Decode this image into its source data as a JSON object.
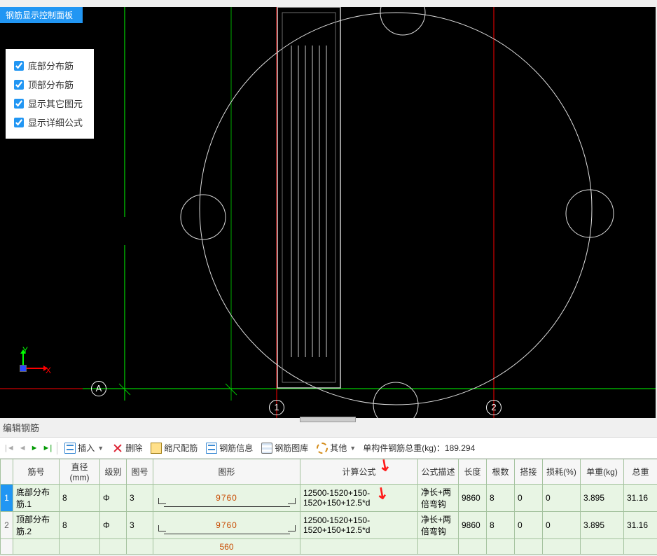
{
  "panel_title": "钢筋显示控制面板",
  "panel_options": [
    "底部分布筋",
    "顶部分布筋",
    "显示其它图元",
    "显示详细公式"
  ],
  "axes": {
    "x": "X",
    "y": "Y"
  },
  "grid_labels": {
    "A": "A",
    "g1": "1",
    "g2": "2"
  },
  "bottom_title": "编辑钢筋",
  "toolbar": {
    "insert": "插入",
    "delete": "删除",
    "scale": "缩尺配筋",
    "info": "钢筋信息",
    "library": "钢筋图库",
    "other": "其他",
    "total_label": "单构件钢筋总重(kg)：",
    "total_value": "189.294"
  },
  "table": {
    "headers": [
      "",
      "筋号",
      "直径(mm)",
      "级别",
      "图号",
      "图形",
      "计算公式",
      "公式描述",
      "长度",
      "根数",
      "搭接",
      "损耗(%)",
      "单重(kg)",
      "总重"
    ],
    "rows": [
      {
        "name": "底部分布筋.1",
        "dia": "8",
        "grade": "Φ",
        "fig_no": "3",
        "shape_val": "9760",
        "formula": "12500-1520+150-1520+150+12.5*d",
        "desc": "净长+两倍弯钩",
        "length": "9860",
        "count": "8",
        "splice": "0",
        "loss": "0",
        "unit_w": "3.895",
        "total_w": "31.16"
      },
      {
        "name": "顶部分布筋.2",
        "dia": "8",
        "grade": "Φ",
        "fig_no": "3",
        "shape_val": "9760",
        "formula": "12500-1520+150-1520+150+12.5*d",
        "desc": "净长+两倍弯钩",
        "length": "9860",
        "count": "8",
        "splice": "0",
        "loss": "0",
        "unit_w": "3.895",
        "total_w": "31.16"
      },
      {
        "name": "",
        "dia": "",
        "grade": "",
        "fig_no": "",
        "shape_val": "560",
        "formula": "",
        "desc": "",
        "length": "",
        "count": "",
        "splice": "",
        "loss": "",
        "unit_w": "",
        "total_w": ""
      }
    ]
  }
}
